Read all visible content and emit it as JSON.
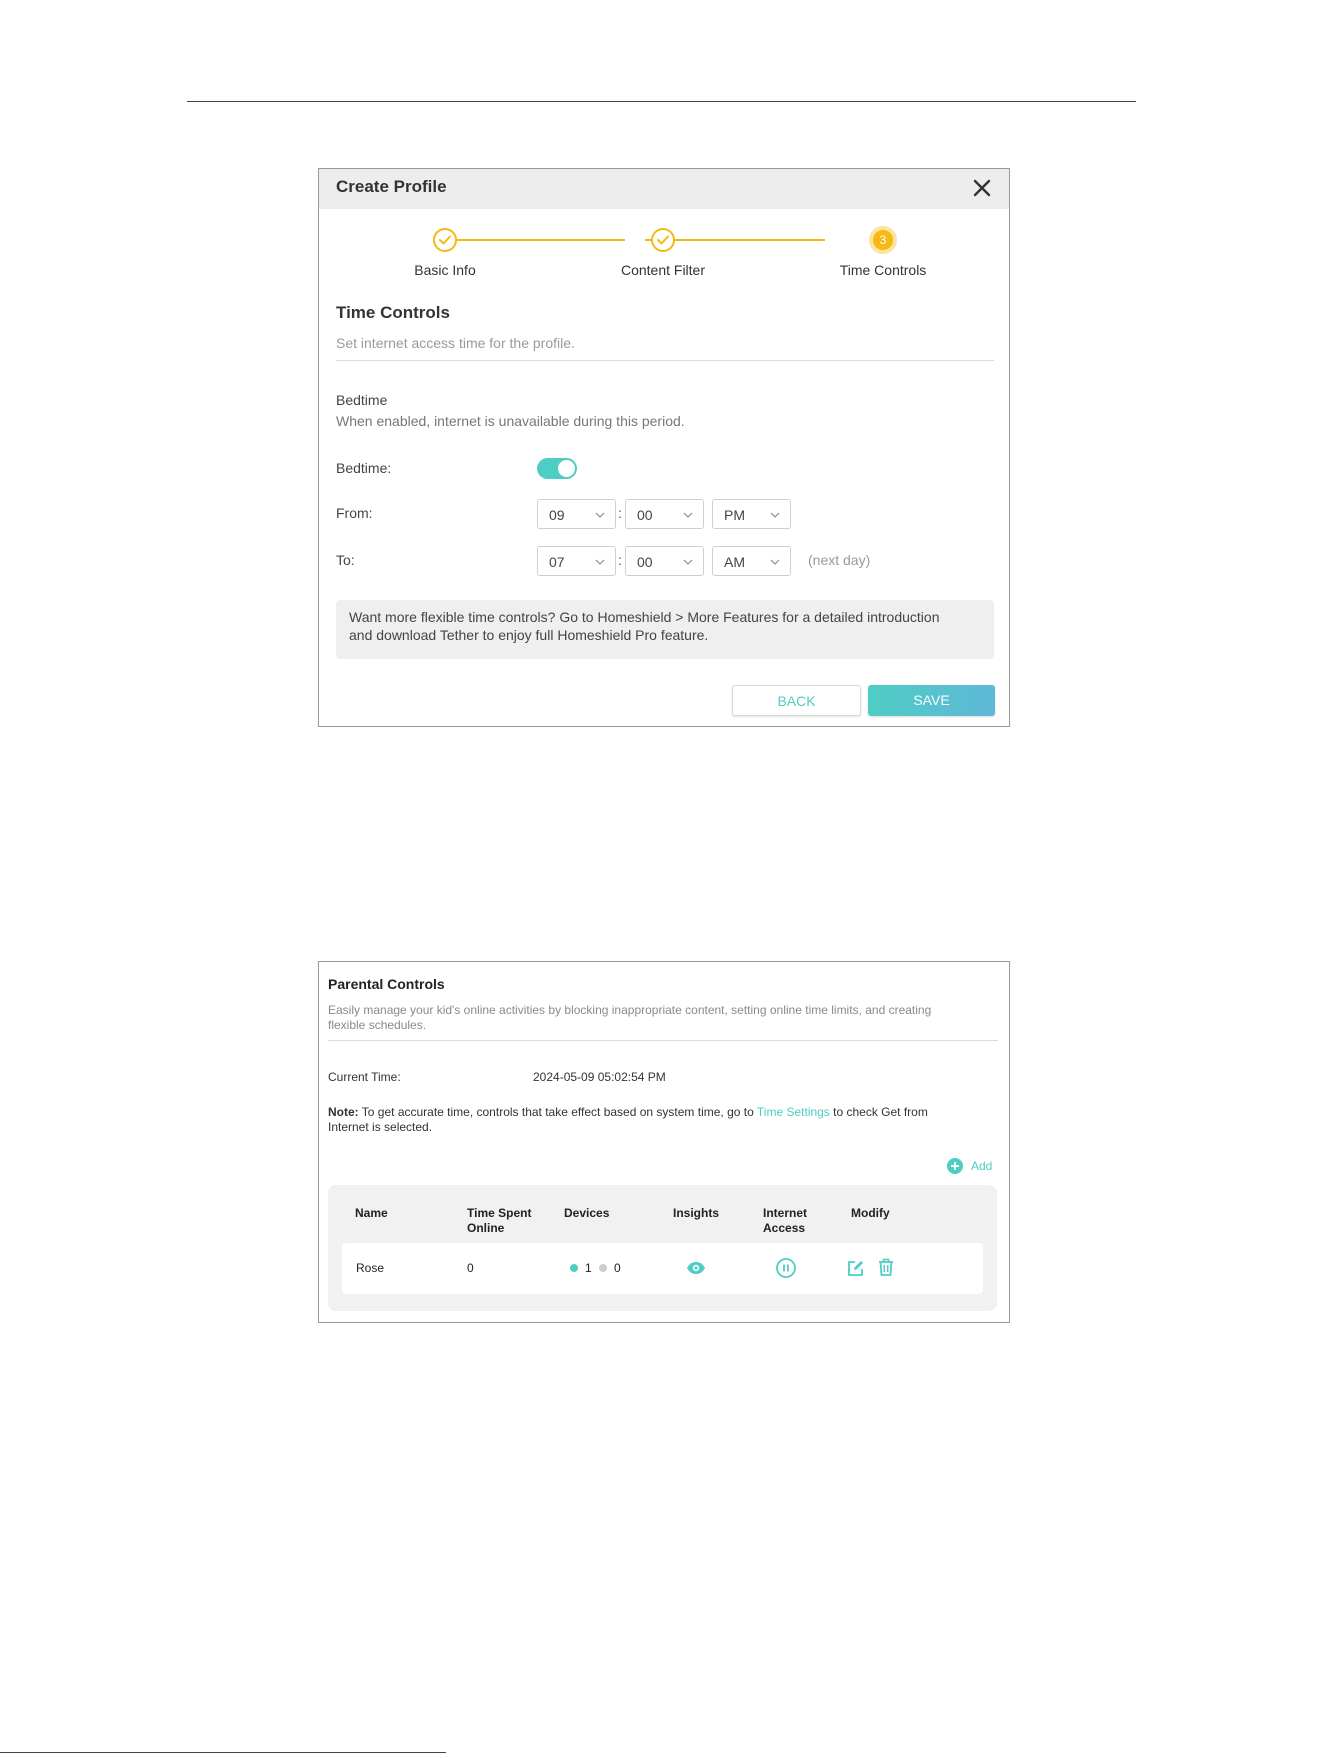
{
  "dialog": {
    "title": "Create Profile",
    "close_icon": "close-icon",
    "steps": [
      {
        "label": "Basic Info",
        "state": "done"
      },
      {
        "label": "Content Filter",
        "state": "done"
      },
      {
        "label": "Time Controls",
        "state": "active",
        "number": "3"
      }
    ],
    "section_title": "Time Controls",
    "section_subtitle": "Set internet access time for the profile.",
    "bedtime_heading": "Bedtime",
    "bedtime_description": "When enabled, internet is unavailable during this period.",
    "bedtime_label": "Bedtime:",
    "bedtime_enabled": true,
    "from_label": "From:",
    "from": {
      "hour": "09",
      "minute": "00",
      "period": "PM"
    },
    "to_label": "To:",
    "to": {
      "hour": "07",
      "minute": "00",
      "period": "AM"
    },
    "colon": ":",
    "next_day": "(next day)",
    "info_line1": "Want more flexible time controls? Go to Homeshield > More Features for a detailed introduction",
    "info_line2": "and download Tether to enjoy full Homeshield Pro feature.",
    "back_label": "BACK",
    "save_label": "SAVE"
  },
  "parental": {
    "title": "Parental Controls",
    "description_line1": "Easily manage your kid's online activities by blocking inappropriate content, setting online time limits, and creating",
    "description_line2": "flexible schedules.",
    "current_time_label": "Current Time:",
    "current_time_value": "2024-05-09 05:02:54 PM",
    "note_bold": "Note:",
    "note_text_before": " To get accurate time, controls that take effect based on system time, go to ",
    "note_link": "Time Settings",
    "note_text_after": " to check Get from",
    "note_line2": "Internet is selected.",
    "add_label": "Add",
    "columns": [
      {
        "line1": "Name",
        "line2": ""
      },
      {
        "line1": "Time Spent",
        "line2": "Online"
      },
      {
        "line1": "Devices",
        "line2": ""
      },
      {
        "line1": "Insights",
        "line2": ""
      },
      {
        "line1": "Internet",
        "line2": "Access"
      },
      {
        "line1": "Modify",
        "line2": ""
      }
    ],
    "rows": [
      {
        "name": "Rose",
        "time_spent": "0",
        "devices_online": "1",
        "devices_offline": "0"
      }
    ]
  },
  "colors": {
    "accent": "#4ecdc4",
    "step": "#f5b914",
    "offline_dot": "#cccccc"
  }
}
